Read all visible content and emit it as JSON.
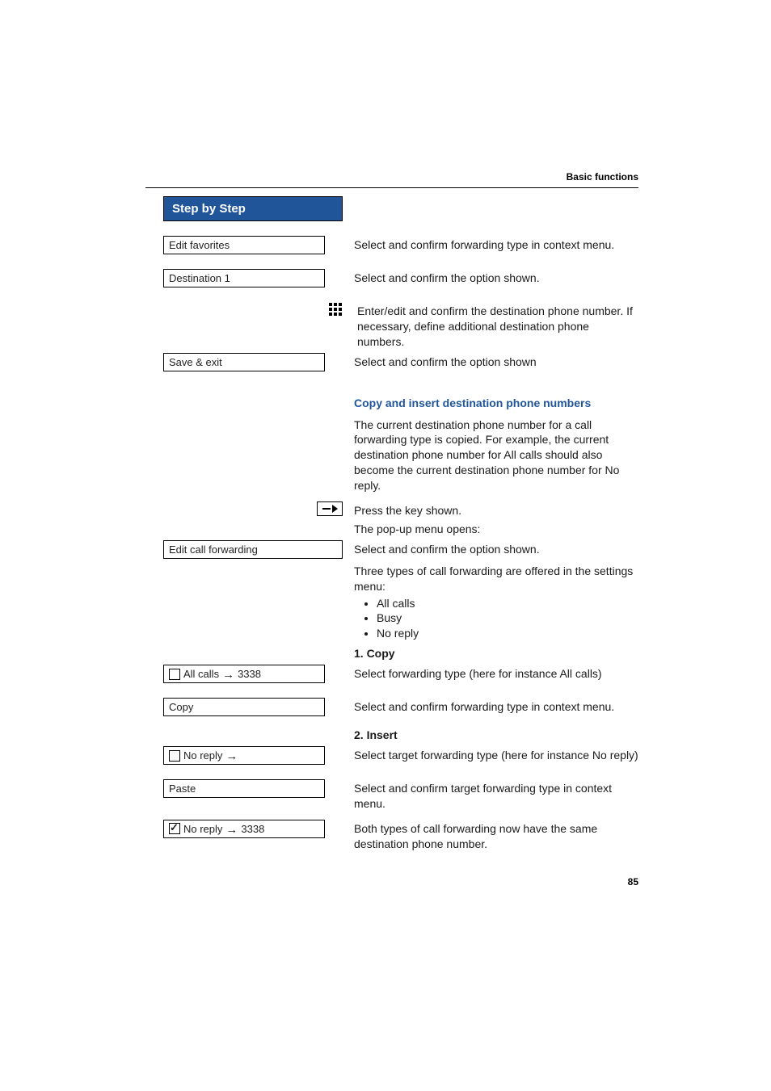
{
  "header": {
    "section": "Basic functions"
  },
  "sidebar": {
    "title": "Step by Step",
    "items": {
      "edit_favorites": "Edit favorites",
      "destination1": "Destination 1",
      "save_exit": "Save & exit",
      "edit_call_forwarding": "Edit call forwarding",
      "all_calls_label": "All calls",
      "all_calls_num": "3338",
      "copy": "Copy",
      "no_reply_label": "No reply",
      "paste": "Paste",
      "no_reply_result_label": "No reply",
      "no_reply_result_num": "3338"
    }
  },
  "body": {
    "t1": "Select and confirm forwarding type in context menu.",
    "t2": "Select and confirm the option shown.",
    "t3": "Enter/edit and confirm the destination phone number. If necessary, define additional destination phone numbers.",
    "t4": "Select and confirm the option shown",
    "h_copy_insert": "Copy and insert destination phone numbers",
    "t5": "The current destination phone number for a call forwarding type is copied. For example, the current destination phone number for All calls should also become the current destination phone number for No reply.",
    "t6": "Press the key shown.",
    "t7": "The pop-up menu opens:",
    "t8": "Select and confirm the option shown.",
    "t9": "Three types of call forwarding are offered in the settings menu:",
    "bullets": [
      "All calls",
      "Busy",
      "No reply"
    ],
    "h_copy": "1.  Copy",
    "t10": "Select forwarding type (here for instance All calls)",
    "t11": "Select and confirm forwarding type in context menu.",
    "h_insert": "2.  Insert",
    "t12": "Select target forwarding type (here for instance No reply)",
    "t13": "Select and confirm target forwarding type in context menu.",
    "t14": "Both types of call forwarding now have the same destination phone number."
  },
  "page_number": "85"
}
